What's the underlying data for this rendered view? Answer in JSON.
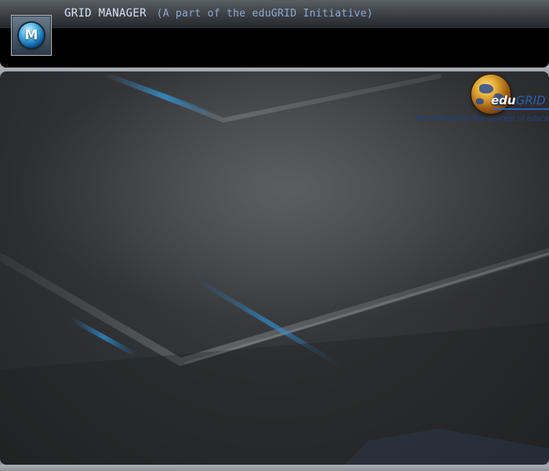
{
  "header": {
    "title": "GRID MANAGER",
    "subtitle": "(A part of the eduGRID Initiative)",
    "icon": {
      "name": "app-logo-m-icon",
      "letter": "M"
    }
  },
  "logo": {
    "brand_part1": "edu",
    "brand_part2": "GRID",
    "tagline": "Revolutionizing the concept of education",
    "icon": "globe-icon"
  },
  "colors": {
    "header_bg": "#000000",
    "title_text": "#d7e3f4",
    "subtitle_text": "#8fa9d0",
    "accent_blue": "#2f9be0",
    "panel_bg": "#333436"
  }
}
